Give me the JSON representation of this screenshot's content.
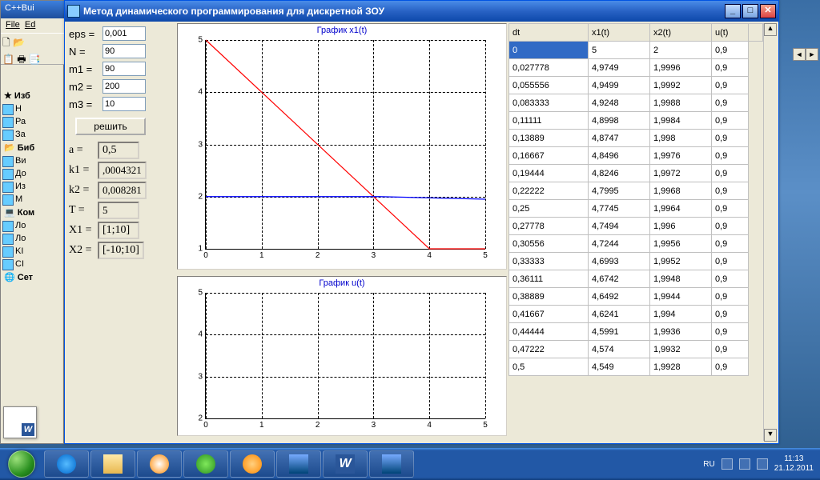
{
  "ide": {
    "title": "C++Bui",
    "menu_file": "File",
    "menu_edit": "Ed",
    "side": [
      "Изб",
      "Н",
      "Ра",
      "За",
      "Биб",
      "Ви",
      "До",
      "Из",
      "М",
      "Ком",
      "Ло",
      "Ло",
      "KI",
      "CI",
      "Сет"
    ]
  },
  "app": {
    "title": "Метод динамического программирования для дискретной ЗОУ",
    "params": {
      "eps_label": "eps =",
      "eps": "0,001",
      "N_label": "N =",
      "N": "90",
      "m1_label": "m1 =",
      "m1": "90",
      "m2_label": "m2 =",
      "m2": "200",
      "m3_label": "m3 =",
      "m3": "10"
    },
    "solve_label": "решить",
    "results": {
      "a_label": "a =",
      "a": "0,5",
      "k1_label": "k1 =",
      "k1": ",0004321",
      "k2_label": "k2 =",
      "k2": "0,008281",
      "T_label": "T =",
      "T": "5",
      "X1_label": "X1 =",
      "X1": "[1;10]",
      "X2_label": "X2 =",
      "X2": "[-10;10]"
    },
    "chart1_title": "График x1(t)",
    "chart2_title": "График u(t)",
    "table_headers": [
      "dt",
      "x1(t)",
      "x2(t)",
      "u(t)"
    ]
  },
  "chart_data": [
    {
      "type": "line",
      "title": "График x1(t)",
      "xlabel": "",
      "ylabel": "",
      "xlim": [
        0,
        5
      ],
      "ylim": [
        1,
        5
      ],
      "series": [
        {
          "name": "red",
          "color": "#ff0000",
          "x": [
            0,
            4,
            5
          ],
          "y": [
            5,
            1,
            1
          ]
        },
        {
          "name": "blue",
          "color": "#0000ff",
          "x": [
            0,
            3.1,
            5
          ],
          "y": [
            2,
            2,
            1.95
          ]
        }
      ]
    },
    {
      "type": "line",
      "title": "График u(t)",
      "xlim": [
        0,
        5
      ],
      "ylim": [
        2,
        5
      ],
      "series": []
    }
  ],
  "table_rows": [
    [
      "0",
      "5",
      "2",
      "0,9"
    ],
    [
      "0,027778",
      "4,9749",
      "1,9996",
      "0,9"
    ],
    [
      "0,055556",
      "4,9499",
      "1,9992",
      "0,9"
    ],
    [
      "0,083333",
      "4,9248",
      "1,9988",
      "0,9"
    ],
    [
      "0,11111",
      "4,8998",
      "1,9984",
      "0,9"
    ],
    [
      "0,13889",
      "4,8747",
      "1,998",
      "0,9"
    ],
    [
      "0,16667",
      "4,8496",
      "1,9976",
      "0,9"
    ],
    [
      "0,19444",
      "4,8246",
      "1,9972",
      "0,9"
    ],
    [
      "0,22222",
      "4,7995",
      "1,9968",
      "0,9"
    ],
    [
      "0,25",
      "4,7745",
      "1,9964",
      "0,9"
    ],
    [
      "0,27778",
      "4,7494",
      "1,996",
      "0,9"
    ],
    [
      "0,30556",
      "4,7244",
      "1,9956",
      "0,9"
    ],
    [
      "0,33333",
      "4,6993",
      "1,9952",
      "0,9"
    ],
    [
      "0,36111",
      "4,6742",
      "1,9948",
      "0,9"
    ],
    [
      "0,38889",
      "4,6492",
      "1,9944",
      "0,9"
    ],
    [
      "0,41667",
      "4,6241",
      "1,994",
      "0,9"
    ],
    [
      "0,44444",
      "4,5991",
      "1,9936",
      "0,9"
    ],
    [
      "0,47222",
      "4,574",
      "1,9932",
      "0,9"
    ],
    [
      "0,5",
      "4,549",
      "1,9928",
      "0,9"
    ]
  ],
  "tray": {
    "lang": "RU",
    "time": "11:13",
    "date": "21.12.2011"
  },
  "taskbar_items": [
    "ie",
    "explorer",
    "wmp",
    "utorrent",
    "mail",
    "cppbuilder",
    "word",
    "app"
  ]
}
